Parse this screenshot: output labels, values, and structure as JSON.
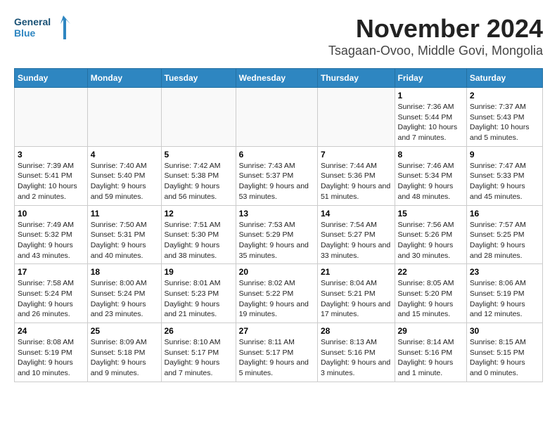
{
  "header": {
    "logo_line1": "General",
    "logo_line2": "Blue",
    "month": "November 2024",
    "location": "Tsagaan-Ovoo, Middle Govi, Mongolia"
  },
  "days_of_week": [
    "Sunday",
    "Monday",
    "Tuesday",
    "Wednesday",
    "Thursday",
    "Friday",
    "Saturday"
  ],
  "weeks": [
    [
      {
        "day": "",
        "info": ""
      },
      {
        "day": "",
        "info": ""
      },
      {
        "day": "",
        "info": ""
      },
      {
        "day": "",
        "info": ""
      },
      {
        "day": "",
        "info": ""
      },
      {
        "day": "1",
        "info": "Sunrise: 7:36 AM\nSunset: 5:44 PM\nDaylight: 10 hours and 7 minutes."
      },
      {
        "day": "2",
        "info": "Sunrise: 7:37 AM\nSunset: 5:43 PM\nDaylight: 10 hours and 5 minutes."
      }
    ],
    [
      {
        "day": "3",
        "info": "Sunrise: 7:39 AM\nSunset: 5:41 PM\nDaylight: 10 hours and 2 minutes."
      },
      {
        "day": "4",
        "info": "Sunrise: 7:40 AM\nSunset: 5:40 PM\nDaylight: 9 hours and 59 minutes."
      },
      {
        "day": "5",
        "info": "Sunrise: 7:42 AM\nSunset: 5:38 PM\nDaylight: 9 hours and 56 minutes."
      },
      {
        "day": "6",
        "info": "Sunrise: 7:43 AM\nSunset: 5:37 PM\nDaylight: 9 hours and 53 minutes."
      },
      {
        "day": "7",
        "info": "Sunrise: 7:44 AM\nSunset: 5:36 PM\nDaylight: 9 hours and 51 minutes."
      },
      {
        "day": "8",
        "info": "Sunrise: 7:46 AM\nSunset: 5:34 PM\nDaylight: 9 hours and 48 minutes."
      },
      {
        "day": "9",
        "info": "Sunrise: 7:47 AM\nSunset: 5:33 PM\nDaylight: 9 hours and 45 minutes."
      }
    ],
    [
      {
        "day": "10",
        "info": "Sunrise: 7:49 AM\nSunset: 5:32 PM\nDaylight: 9 hours and 43 minutes."
      },
      {
        "day": "11",
        "info": "Sunrise: 7:50 AM\nSunset: 5:31 PM\nDaylight: 9 hours and 40 minutes."
      },
      {
        "day": "12",
        "info": "Sunrise: 7:51 AM\nSunset: 5:30 PM\nDaylight: 9 hours and 38 minutes."
      },
      {
        "day": "13",
        "info": "Sunrise: 7:53 AM\nSunset: 5:29 PM\nDaylight: 9 hours and 35 minutes."
      },
      {
        "day": "14",
        "info": "Sunrise: 7:54 AM\nSunset: 5:27 PM\nDaylight: 9 hours and 33 minutes."
      },
      {
        "day": "15",
        "info": "Sunrise: 7:56 AM\nSunset: 5:26 PM\nDaylight: 9 hours and 30 minutes."
      },
      {
        "day": "16",
        "info": "Sunrise: 7:57 AM\nSunset: 5:25 PM\nDaylight: 9 hours and 28 minutes."
      }
    ],
    [
      {
        "day": "17",
        "info": "Sunrise: 7:58 AM\nSunset: 5:24 PM\nDaylight: 9 hours and 26 minutes."
      },
      {
        "day": "18",
        "info": "Sunrise: 8:00 AM\nSunset: 5:24 PM\nDaylight: 9 hours and 23 minutes."
      },
      {
        "day": "19",
        "info": "Sunrise: 8:01 AM\nSunset: 5:23 PM\nDaylight: 9 hours and 21 minutes."
      },
      {
        "day": "20",
        "info": "Sunrise: 8:02 AM\nSunset: 5:22 PM\nDaylight: 9 hours and 19 minutes."
      },
      {
        "day": "21",
        "info": "Sunrise: 8:04 AM\nSunset: 5:21 PM\nDaylight: 9 hours and 17 minutes."
      },
      {
        "day": "22",
        "info": "Sunrise: 8:05 AM\nSunset: 5:20 PM\nDaylight: 9 hours and 15 minutes."
      },
      {
        "day": "23",
        "info": "Sunrise: 8:06 AM\nSunset: 5:19 PM\nDaylight: 9 hours and 12 minutes."
      }
    ],
    [
      {
        "day": "24",
        "info": "Sunrise: 8:08 AM\nSunset: 5:19 PM\nDaylight: 9 hours and 10 minutes."
      },
      {
        "day": "25",
        "info": "Sunrise: 8:09 AM\nSunset: 5:18 PM\nDaylight: 9 hours and 9 minutes."
      },
      {
        "day": "26",
        "info": "Sunrise: 8:10 AM\nSunset: 5:17 PM\nDaylight: 9 hours and 7 minutes."
      },
      {
        "day": "27",
        "info": "Sunrise: 8:11 AM\nSunset: 5:17 PM\nDaylight: 9 hours and 5 minutes."
      },
      {
        "day": "28",
        "info": "Sunrise: 8:13 AM\nSunset: 5:16 PM\nDaylight: 9 hours and 3 minutes."
      },
      {
        "day": "29",
        "info": "Sunrise: 8:14 AM\nSunset: 5:16 PM\nDaylight: 9 hours and 1 minute."
      },
      {
        "day": "30",
        "info": "Sunrise: 8:15 AM\nSunset: 5:15 PM\nDaylight: 9 hours and 0 minutes."
      }
    ]
  ]
}
